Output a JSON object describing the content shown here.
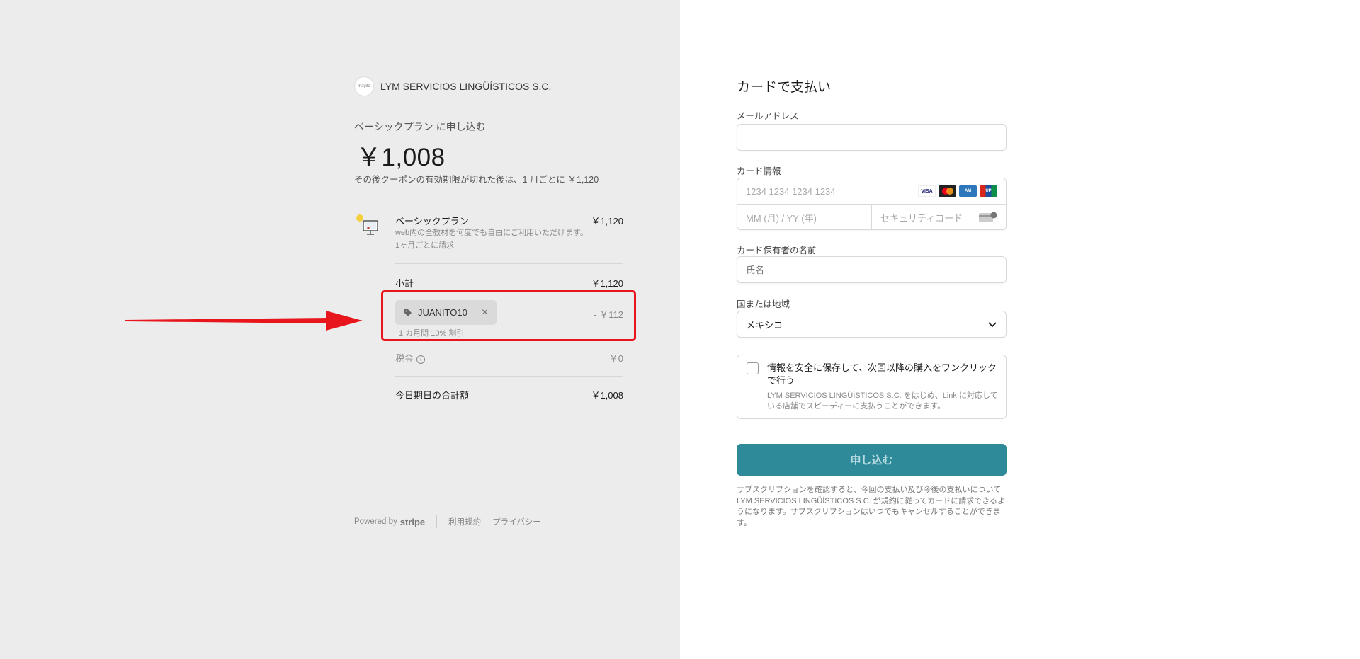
{
  "merchant": {
    "logo_text": "mayita",
    "name": "LYM SERVICIOS LINGÜÍSTICOS S.C."
  },
  "summary": {
    "subscribe_title": "ベーシックプラン に申し込む",
    "price": "￥1,008",
    "price_note": "その後クーポンの有効期限が切れた後は、1 月ごとに ￥1,120"
  },
  "line_item": {
    "name": "ベーシックプラン",
    "amount": "￥1,120",
    "description": "web内の全教材を何度でも自由にご利用いただけます。",
    "billing": "1ヶ月ごとに請求"
  },
  "subtotal": {
    "label": "小計",
    "amount": "￥1,120"
  },
  "coupon": {
    "code": "JUANITO10",
    "discount": "- ￥112",
    "note": "1 カ月間 10% 割引"
  },
  "tax": {
    "label": "税金",
    "amount": "￥0"
  },
  "total": {
    "label": "今日期日の合計額",
    "amount": "￥1,008"
  },
  "footer": {
    "powered_by": "Powered by",
    "brand": "stripe",
    "terms": "利用規約",
    "privacy": "プライバシー"
  },
  "form": {
    "title": "カードで支払い",
    "email_label": "メールアドレス",
    "email_value": "",
    "card_label": "カード情報",
    "card_number_placeholder": "1234 1234 1234 1234",
    "card_brands": [
      "VISA",
      "MC",
      "AMEX",
      "UnionPay"
    ],
    "expiry_placeholder": "MM (月) / YY (年)",
    "cvc_placeholder": "セキュリティコード",
    "name_label": "カード保有者の名前",
    "name_placeholder": "氏名",
    "country_label": "国または地域",
    "country_value": "メキシコ",
    "save_title": "情報を安全に保存して、次回以降の購入をワンクリックで行う",
    "save_desc": "LYM SERVICIOS LINGÜÍSTICOS S.C. をはじめ、Link に対応している店舗でスピーディーに支払うことができます。",
    "submit_label": "申し込む",
    "legal": "サブスクリプションを確認すると、今回の支払い及び今後の支払いについて LYM SERVICIOS LINGÜÍSTICOS S.C. が規約に従ってカードに請求できるようになります。サブスクリプションはいつでもキャンセルすることができます。"
  },
  "colors": {
    "highlight": "#e8161c",
    "submit": "#2e8a99",
    "left_bg": "#ececec"
  }
}
